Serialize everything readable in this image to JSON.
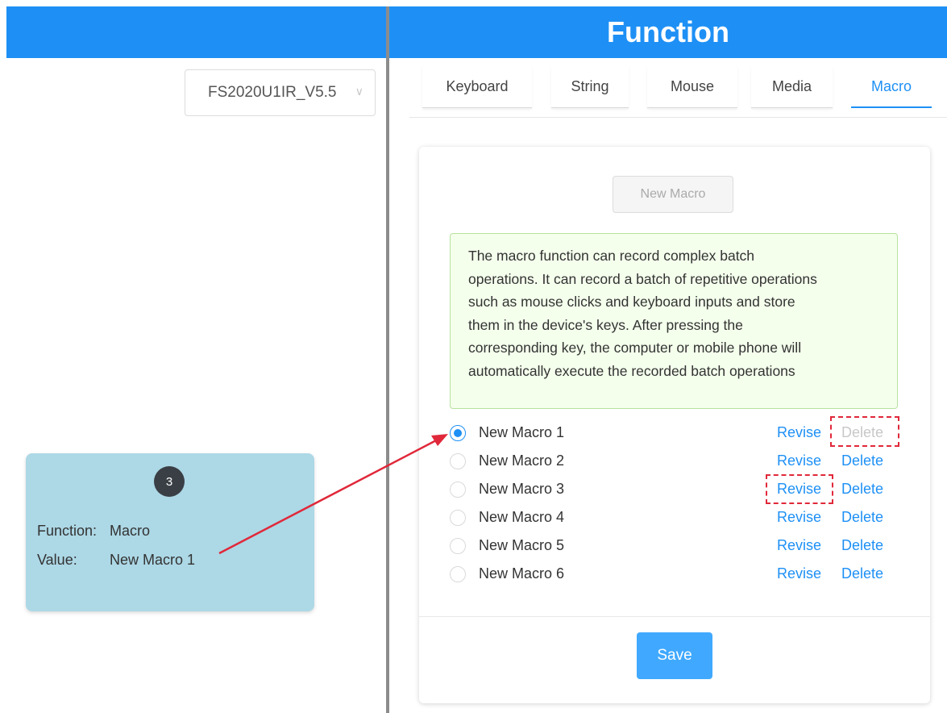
{
  "header": {
    "title": "Function"
  },
  "device": {
    "selected": "FS2020U1IR_V5.5"
  },
  "tabs": [
    {
      "label": "Keyboard"
    },
    {
      "label": "String"
    },
    {
      "label": "Mouse"
    },
    {
      "label": "Media"
    },
    {
      "label": "Macro",
      "active": true
    }
  ],
  "macro_panel": {
    "new_macro_label": "New Macro",
    "description_lines": [
      "The macro function can record complex batch",
      "operations. It can record a batch of repetitive operations",
      "such as mouse clicks and keyboard inputs and store",
      "them in the device's keys. After pressing the",
      "corresponding key, the computer or mobile phone will",
      "automatically execute the recorded batch operations"
    ],
    "macros": [
      {
        "name": "New Macro 1",
        "selected": true,
        "revise": "Revise",
        "delete": "Delete",
        "delete_disabled": true
      },
      {
        "name": "New Macro 2",
        "selected": false,
        "revise": "Revise",
        "delete": "Delete"
      },
      {
        "name": "New Macro 3",
        "selected": false,
        "revise": "Revise",
        "delete": "Delete"
      },
      {
        "name": "New Macro 4",
        "selected": false,
        "revise": "Revise",
        "delete": "Delete"
      },
      {
        "name": "New Macro 5",
        "selected": false,
        "revise": "Revise",
        "delete": "Delete"
      },
      {
        "name": "New Macro 6",
        "selected": false,
        "revise": "Revise",
        "delete": "Delete"
      }
    ],
    "save_label": "Save"
  },
  "key_card": {
    "number": "3",
    "function_label": "Function:",
    "function_value": "Macro",
    "value_label": "Value:",
    "value_value": "New Macro 1"
  },
  "colors": {
    "primary": "#1e90f5",
    "highlight": "#e0283a",
    "key_card_bg": "#add8e6"
  }
}
